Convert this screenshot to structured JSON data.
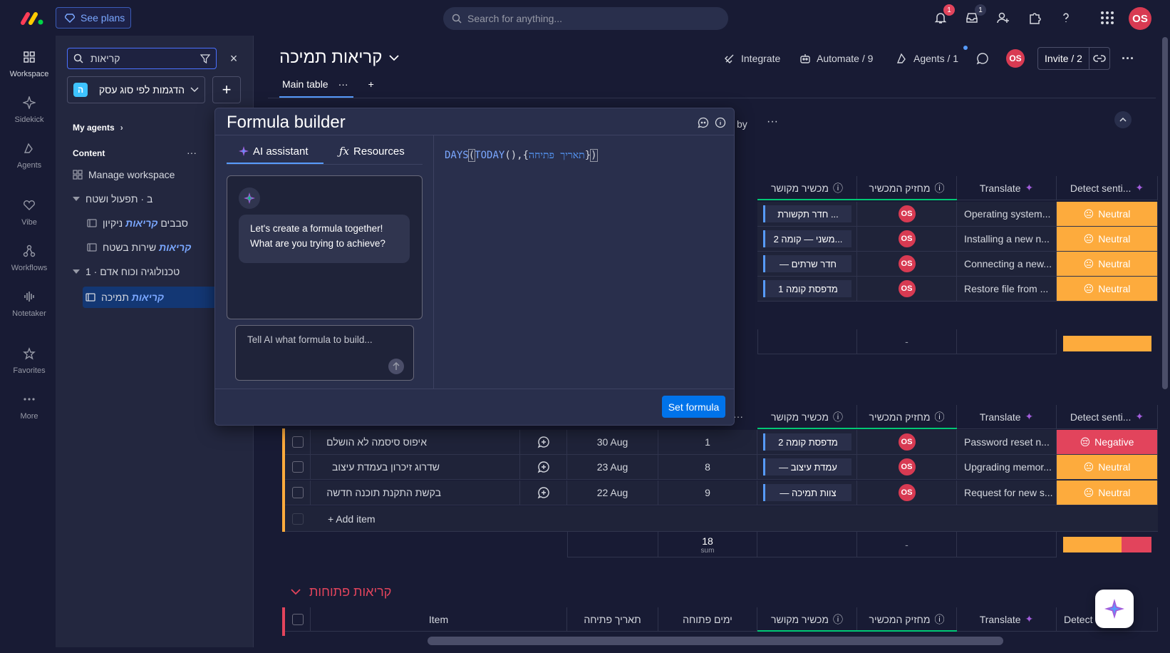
{
  "topbar": {
    "see_plans": "See plans",
    "search_placeholder": "Search for anything...",
    "notifications_count": "1",
    "inbox_count": "1",
    "avatar": "OS"
  },
  "rail": {
    "items": [
      "Workspace",
      "Sidekick",
      "Agents",
      "Vibe",
      "Workflows",
      "Notetaker",
      "Favorites",
      "More"
    ]
  },
  "workspace": {
    "search_value": "קריאות",
    "selector_label": "הדגמות לפי סוג עסק",
    "selector_letter": "ה",
    "my_agents": "My agents",
    "content": "Content",
    "manage": "Manage workspace",
    "folder1": "ב · תפעול ושטח",
    "board1a_pre": "קריאות",
    "board1a_post": "סבבים ",
    "board1a_tail": " ניקיון",
    "board1b_pre": "קריאות",
    "board1b_post": "שירות בשטח ",
    "folder2": "1 · טכנולוגיה וכוח אדם",
    "board2_pre": "קריאות",
    "board2_post": "תמיכה "
  },
  "board": {
    "title": "קריאות תמיכה",
    "tab_main": "Main table",
    "integrate": "Integrate",
    "automate": "Automate / 9",
    "agents": "Agents / 1",
    "invite": "Invite / 2",
    "by": "by",
    "avatar": "OS"
  },
  "columns": {
    "item": "Item",
    "open_date": "תאריך פתיחה",
    "open_days": "ימים פתוחה",
    "device": "מכשיר מקושר",
    "holder": "מחזיק המכשיר",
    "translate": "Translate",
    "detect": "Detect senti...",
    "detect_short": "Detect"
  },
  "group1": {
    "rows": [
      {
        "device": "חדר תקשורת ...",
        "holder": "OS",
        "translate": "Operating system...",
        "sentiment": "Neutral"
      },
      {
        "device": "משני — קומה 2...",
        "holder": "OS",
        "translate": "Installing a new n...",
        "sentiment": "Neutral"
      },
      {
        "device": "— חדר שרתים",
        "holder": "OS",
        "translate": "Connecting a new...",
        "sentiment": "Neutral"
      },
      {
        "device": "מדפסת קומה 1",
        "holder": "OS",
        "translate": "Restore file from ...",
        "sentiment": "Neutral"
      }
    ],
    "summary_dash": "-"
  },
  "group2": {
    "rows": [
      {
        "item": "איפוס סיסמה לא הושלם",
        "date": "30 Aug",
        "days": "1",
        "device": "מדפסת קומה 2",
        "holder": "OS",
        "translate": "Password reset n...",
        "sentiment": "Negative"
      },
      {
        "item": "שדרוג זיכרון בעמדת עיצוב",
        "date": "23 Aug",
        "days": "8",
        "device": "— עמדת עיצוב",
        "holder": "OS",
        "translate": "Upgrading memor...",
        "sentiment": "Neutral"
      },
      {
        "item": "בקשת התקנת תוכנה חדשה",
        "date": "22 Aug",
        "days": "9",
        "device": "— צוות תמיכה",
        "holder": "OS",
        "translate": "Request for new s...",
        "sentiment": "Neutral"
      }
    ],
    "add_item": "+ Add item",
    "sum_value": "18",
    "sum_label": "sum",
    "summary_dash": "-"
  },
  "group3": {
    "title": "קריאות פתוחות"
  },
  "formula_builder": {
    "title": "Formula builder",
    "tab_ai": "AI assistant",
    "tab_resources": "Resources",
    "bubble": "Let's create a formula together! What are you trying to achieve?",
    "input_placeholder": "Tell AI what formula to build...",
    "code_fn1": "DAYS",
    "code_fn2": "TODAY",
    "code_col": "תאריך פתיחה",
    "set_button": "Set formula"
  },
  "colors": {
    "neutral": "#fdab3d",
    "negative": "#e2445c",
    "accent": "#0073ea"
  }
}
